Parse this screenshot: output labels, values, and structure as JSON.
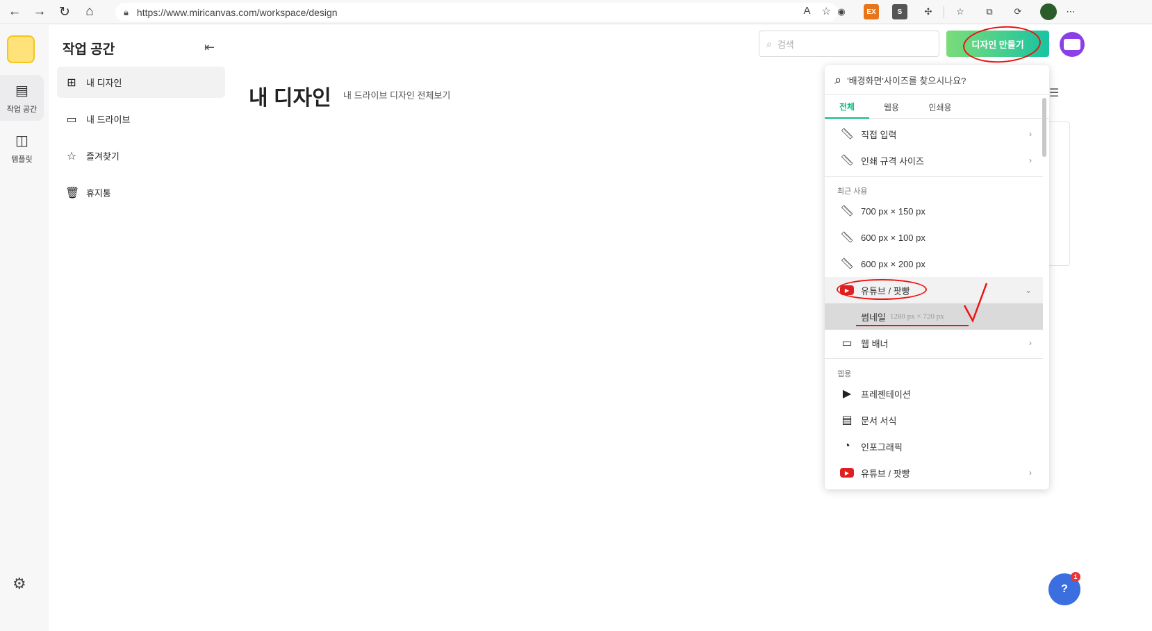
{
  "browser": {
    "url": "https://www.miricanvas.com/workspace/design"
  },
  "rail": {
    "items": [
      {
        "label": "작업 공간"
      },
      {
        "label": "템플릿"
      }
    ]
  },
  "sidebar": {
    "title": "작업 공간",
    "items": [
      {
        "label": "내 디자인"
      },
      {
        "label": "내 드라이브"
      },
      {
        "label": "즐겨찾기"
      },
      {
        "label": "휴지통"
      }
    ]
  },
  "main": {
    "title": "내 디자인",
    "subtitle": "내 드라이브 디자인 전체보기",
    "search_placeholder": "검색",
    "create_button": "디자인 만들기"
  },
  "dropdown": {
    "search_placeholder": "'배경화면'사이즈를 찾으시나요?",
    "tabs": [
      "전체",
      "웹용",
      "인쇄용"
    ],
    "custom": [
      "직접 입력",
      "인쇄 규격 사이즈"
    ],
    "recent_header": "최근 사용",
    "recent": [
      "700 px × 150 px",
      "600 px × 100 px",
      "600 px × 200 px"
    ],
    "youtube_group": "유튜브 / 팟빵",
    "thumbnail": {
      "label": "썸네일",
      "size": "1280 px × 720 px"
    },
    "web_banner": "웹 배너",
    "web_header": "웹용",
    "web_items": [
      "프레젠테이션",
      "문서 서식",
      "인포그래픽",
      "유튜브 / 팟빵"
    ]
  },
  "help": {
    "badge": "1",
    "label": "?"
  },
  "colors": {
    "accent": "#12b886",
    "brand_purple": "#8b3fe6",
    "annotation": "#e11111"
  }
}
